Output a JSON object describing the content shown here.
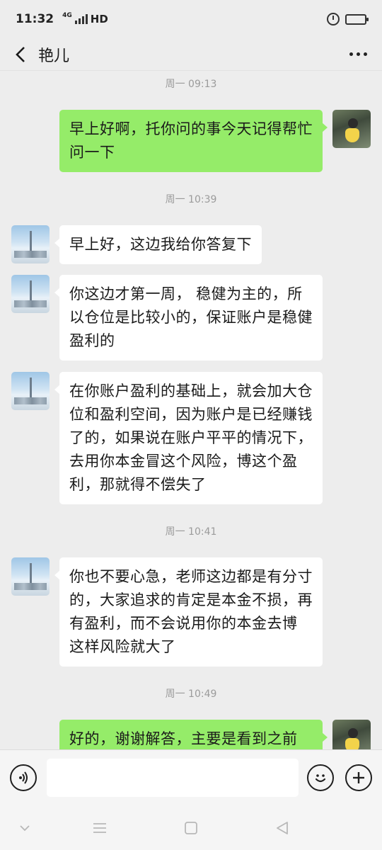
{
  "status_bar": {
    "time": "11:32",
    "network": "4G",
    "hd": "HD",
    "icons": [
      "signal-icon",
      "alarm-icon",
      "battery-icon"
    ],
    "battery_color": "#f5c518"
  },
  "header": {
    "back_icon": "chevron-left-icon",
    "title": "艳儿",
    "more_icon": "more-dots-icon"
  },
  "chat": {
    "timestamps": [
      "周一 09:13",
      "周一 10:39",
      "周一 10:41",
      "周一 10:49"
    ],
    "messages": [
      {
        "from": "me",
        "text": "早上好啊，托你问的事今天记得帮忙问一下"
      },
      {
        "from": "other",
        "text": "早上好，这边我给你答复下"
      },
      {
        "from": "other",
        "text": "你这边才第一周， 稳健为主的，所以仓位是比较小的，保证账户是稳健盈利的"
      },
      {
        "from": "other",
        "text": "在你账户盈利的基础上，就会加大仓位和盈利空间，因为账户是已经赚钱了的，如果说在账户平平的情况下，去用你本金冒这个风险，博这个盈利，那就得不偿失了"
      },
      {
        "from": "other",
        "text": "你也不要心急，老师这边都是有分寸的，大家追求的肯定是本金不损，再有盈利，而不会说用你的本金去博 这样风险就大了"
      },
      {
        "from": "me",
        "text": "好的，谢谢解答，主要是看到之前"
      }
    ],
    "colors": {
      "me_bubble": "#95ec69",
      "other_bubble": "#ffffff",
      "background": "#ededed"
    }
  },
  "input_bar": {
    "voice_icon": "voice-icon",
    "input_value": "",
    "emoji_icon": "emoji-icon",
    "plus_icon": "plus-icon"
  },
  "nav_bar": {
    "icons": [
      "collapse-chevron-icon",
      "menu-icon",
      "home-square-icon",
      "back-triangle-icon"
    ]
  }
}
